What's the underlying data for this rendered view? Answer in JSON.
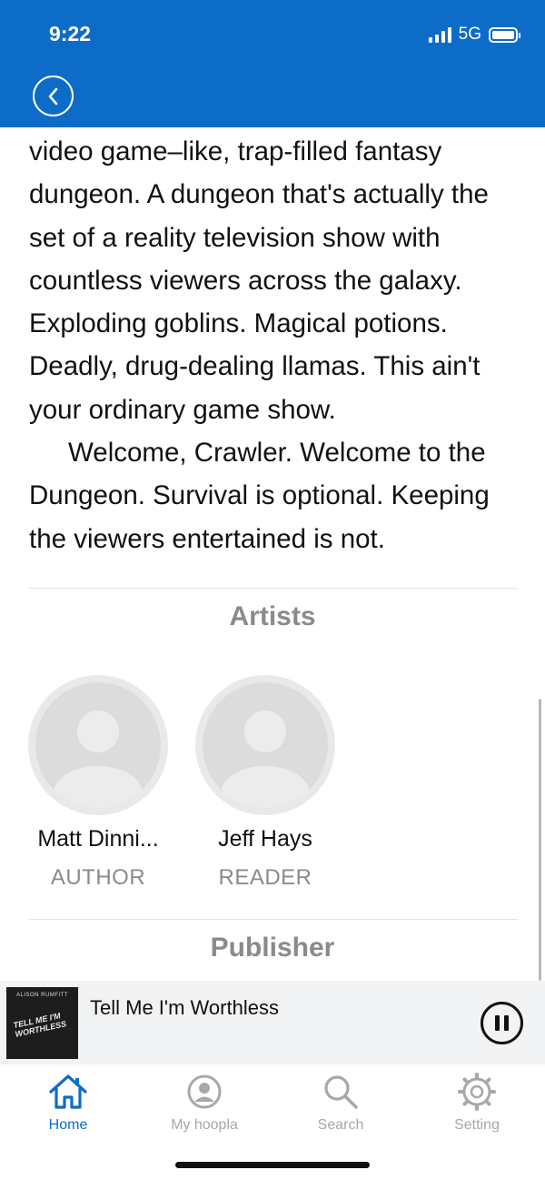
{
  "status_bar": {
    "time": "9:22",
    "network": "5G"
  },
  "header": {
    "back_icon": "chevron-left-circle-icon"
  },
  "description": {
    "paragraphs": [
      "video game–like, trap-filled fantasy dungeon. A dungeon that's actually the set of a reality television show with countless viewers across the galaxy. Exploding goblins. Magical potions. Deadly, drug-dealing llamas. This ain't your ordinary game show.",
      "Welcome, Crawler. Welcome to the Dungeon. Survival is optional. Keeping the viewers entertained is not."
    ]
  },
  "artists_section": {
    "title": "Artists",
    "artists": [
      {
        "name": "Matt Dinni...",
        "role": "AUTHOR"
      },
      {
        "name": "Jeff Hays",
        "role": "READER"
      }
    ]
  },
  "publisher_section": {
    "title": "Publisher"
  },
  "now_playing": {
    "title": "Tell Me I'm Worthless",
    "cover_author": "ALISON RUMFITT",
    "cover_title": "TELL ME I'M WORTHLESS",
    "state_icon": "pause-icon"
  },
  "tab_bar": {
    "tabs": [
      {
        "label": "Home",
        "icon": "home-icon",
        "active": true
      },
      {
        "label": "My hoopla",
        "icon": "user-circle-icon",
        "active": false
      },
      {
        "label": "Search",
        "icon": "search-icon",
        "active": false
      },
      {
        "label": "Setting",
        "icon": "gear-icon",
        "active": false
      }
    ]
  },
  "colors": {
    "brand_blue": "#0d6cc7",
    "muted_gray": "#8a8a8a"
  }
}
